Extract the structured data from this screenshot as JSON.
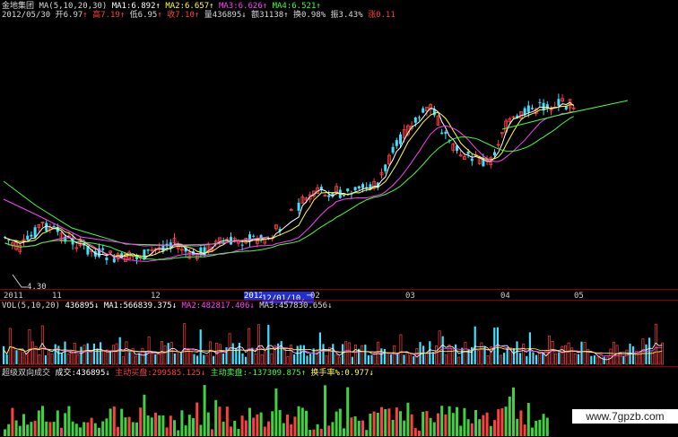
{
  "header": {
    "stock_name": "金地集团",
    "ma_label": "MA(5,10,20,30)",
    "ma1": "MA1:6.892",
    "ma2": "MA2:6.657",
    "ma3": "MA3:6.626",
    "ma4": "MA4:6.521",
    "date": "2012/05/30",
    "open": "开6.97",
    "high": "高7.19",
    "low": "低6.95",
    "close": "收7.10",
    "volume": "量436895",
    "amount": "额31138",
    "turnover": "换0.98%",
    "amplitude": "振3.43%",
    "change": "涨0.11"
  },
  "main_chart": {
    "low_label": "4.30",
    "xaxis": [
      {
        "label": "2011"
      },
      {
        "label": "11"
      },
      {
        "label": "12"
      },
      {
        "label": "2012"
      },
      {
        "label": "12/01/10,二"
      },
      {
        "label": "02"
      },
      {
        "label": "03"
      },
      {
        "label": "04"
      },
      {
        "label": "05"
      }
    ]
  },
  "volume_panel": {
    "title": "VOL(5,10,20)",
    "vol": "436895",
    "ma1": "MA1:566839.375",
    "ma2": "MA2:482817.406",
    "ma3": "MA3:457830.656"
  },
  "flow_panel": {
    "title": "超级双向成交",
    "deal": "成交:436895",
    "buy": "主动买盘:299585.125",
    "sell": "主动卖盘:-137309.875",
    "turnover": "换手率%:0.977"
  },
  "watermark": "www.7gpzb.com",
  "colors": {
    "up": "#ff4040",
    "down": "#40e0ff",
    "ma1": "#ffffff",
    "ma2": "#ffff40",
    "ma3": "#ff40ff",
    "ma4": "#40ff40"
  }
}
